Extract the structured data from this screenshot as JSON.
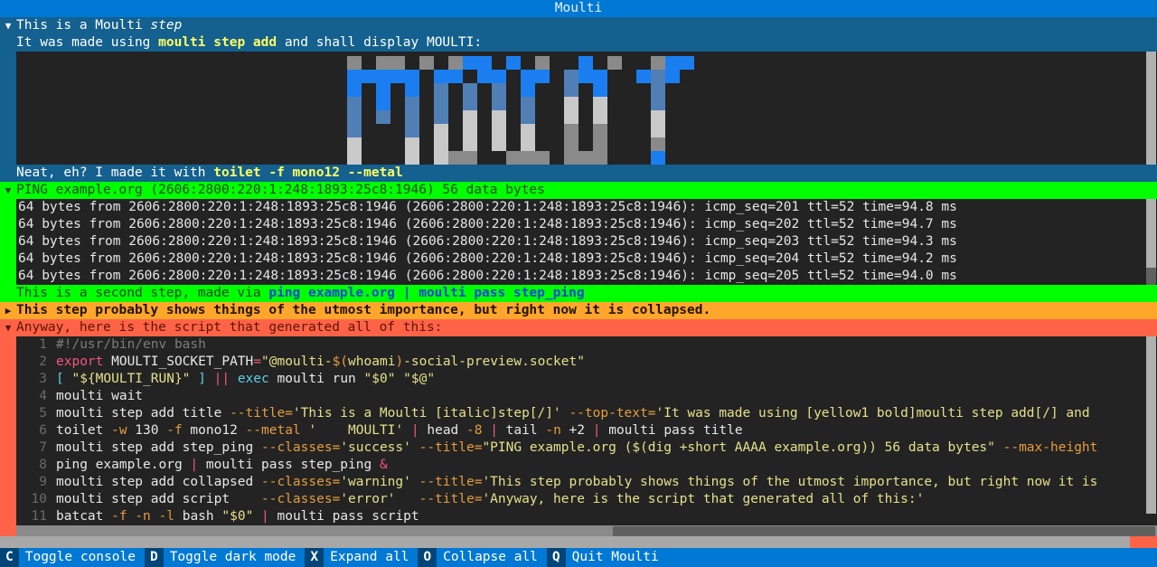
{
  "window": {
    "title": "Moulti"
  },
  "steps": [
    {
      "id": "title",
      "collapse_icon": "▼",
      "title": "This is a Moulti step",
      "title_italic_word": "step",
      "top_text_prefix": "It was made using ",
      "top_text_cmd": "moulti step add",
      "top_text_suffix": " and shall display MOULTI:",
      "bottom_text_prefix": "Neat, eh? I made it with ",
      "bottom_text_cmd": "toilet -f mono12 --metal",
      "art_alt": "MOULTI rendered as metal-style block letters"
    },
    {
      "id": "step_ping",
      "collapse_icon": "▼",
      "title": "PING example.org (2606:2800:220:1:248:1893:25c8:1946) 56 data bytes",
      "log_lines": [
        "64 bytes from 2606:2800:220:1:248:1893:25c8:1946 (2606:2800:220:1:248:1893:25c8:1946): icmp_seq=201 ttl=52 time=94.8 ms",
        "64 bytes from 2606:2800:220:1:248:1893:25c8:1946 (2606:2800:220:1:248:1893:25c8:1946): icmp_seq=202 ttl=52 time=94.7 ms",
        "64 bytes from 2606:2800:220:1:248:1893:25c8:1946 (2606:2800:220:1:248:1893:25c8:1946): icmp_seq=203 ttl=52 time=94.3 ms",
        "64 bytes from 2606:2800:220:1:248:1893:25c8:1946 (2606:2800:220:1:248:1893:25c8:1946): icmp_seq=204 ttl=52 time=94.2 ms",
        "64 bytes from 2606:2800:220:1:248:1893:25c8:1946 (2606:2800:220:1:248:1893:25c8:1946): icmp_seq=205 ttl=52 time=94.0 ms"
      ],
      "bottom_text_prefix": "This is a second step, made via ",
      "bottom_text_cmd": "ping example.org | moulti pass step_ping"
    },
    {
      "id": "collapsed",
      "collapse_icon": "▶",
      "title": "This step probably shows things of the utmost importance, but right now it is collapsed."
    },
    {
      "id": "script",
      "collapse_icon": "▼",
      "title": "Anyway, here is the script that generated all of this:"
    }
  ],
  "code": {
    "lines": [
      {
        "n": "1",
        "tokens": [
          {
            "t": "#!/usr/bin/env bash",
            "c": "c-com"
          }
        ]
      },
      {
        "n": "2",
        "tokens": [
          {
            "t": "export",
            "c": "c-kw"
          },
          {
            "t": " MOULTI_SOCKET_PATH",
            "c": "c-var"
          },
          {
            "t": "=",
            "c": "c-op"
          },
          {
            "t": "\"",
            "c": "c-str"
          },
          {
            "t": "@moulti-",
            "c": "c-str"
          },
          {
            "t": "$(",
            "c": "c-flag"
          },
          {
            "t": "whoami",
            "c": "c-str"
          },
          {
            "t": ")",
            "c": "c-flag"
          },
          {
            "t": "-social-preview.socket\"",
            "c": "c-str"
          }
        ]
      },
      {
        "n": "3",
        "tokens": [
          {
            "t": "[ ",
            "c": "c-cyan"
          },
          {
            "t": "\"${MOULTI_RUN}\"",
            "c": "c-str"
          },
          {
            "t": " ]",
            "c": "c-cyan"
          },
          {
            "t": " ||",
            "c": "c-op"
          },
          {
            "t": " exec",
            "c": "c-cyan"
          },
          {
            "t": " moulti run ",
            "c": "c-plain"
          },
          {
            "t": "\"$0\" \"$@\"",
            "c": "c-str"
          }
        ]
      },
      {
        "n": "4",
        "tokens": [
          {
            "t": "moulti wait",
            "c": "c-plain"
          }
        ]
      },
      {
        "n": "5",
        "tokens": [
          {
            "t": "moulti step add title ",
            "c": "c-plain"
          },
          {
            "t": "--title=",
            "c": "c-flag"
          },
          {
            "t": "'This is a Moulti [italic]step[/]'",
            "c": "c-str"
          },
          {
            "t": " --top-text=",
            "c": "c-flag"
          },
          {
            "t": "'It was made using [yellow1 bold]moulti step add[/] and",
            "c": "c-str"
          }
        ]
      },
      {
        "n": "6",
        "tokens": [
          {
            "t": "toilet ",
            "c": "c-plain"
          },
          {
            "t": "-w",
            "c": "c-flag"
          },
          {
            "t": " 130 ",
            "c": "c-plain"
          },
          {
            "t": "-f",
            "c": "c-flag"
          },
          {
            "t": " mono12 ",
            "c": "c-plain"
          },
          {
            "t": "--metal",
            "c": "c-flag"
          },
          {
            "t": " '    MOULTI'",
            "c": "c-str"
          },
          {
            "t": " |",
            "c": "c-op"
          },
          {
            "t": " head ",
            "c": "c-plain"
          },
          {
            "t": "-8",
            "c": "c-flag"
          },
          {
            "t": " |",
            "c": "c-op"
          },
          {
            "t": " tail ",
            "c": "c-plain"
          },
          {
            "t": "-n",
            "c": "c-flag"
          },
          {
            "t": " +2",
            "c": "c-plain"
          },
          {
            "t": " |",
            "c": "c-op"
          },
          {
            "t": " moulti pass title",
            "c": "c-plain"
          }
        ]
      },
      {
        "n": "7",
        "tokens": [
          {
            "t": "moulti step add step_ping ",
            "c": "c-plain"
          },
          {
            "t": "--classes=",
            "c": "c-flag"
          },
          {
            "t": "'success'",
            "c": "c-str"
          },
          {
            "t": " --title=",
            "c": "c-flag"
          },
          {
            "t": "\"PING example.org ($(dig +short AAAA example.org)) 56 data bytes\"",
            "c": "c-str"
          },
          {
            "t": " --max-height",
            "c": "c-flag"
          }
        ]
      },
      {
        "n": "8",
        "tokens": [
          {
            "t": "ping example.org ",
            "c": "c-plain"
          },
          {
            "t": "|",
            "c": "c-op"
          },
          {
            "t": " moulti pass step_ping ",
            "c": "c-plain"
          },
          {
            "t": "&",
            "c": "c-amp"
          }
        ]
      },
      {
        "n": "9",
        "tokens": [
          {
            "t": "moulti step add collapsed ",
            "c": "c-plain"
          },
          {
            "t": "--classes=",
            "c": "c-flag"
          },
          {
            "t": "'warning'",
            "c": "c-str"
          },
          {
            "t": " --title=",
            "c": "c-flag"
          },
          {
            "t": "'This step probably shows things of the utmost importance, but right now it is",
            "c": "c-str"
          }
        ]
      },
      {
        "n": "10",
        "tokens": [
          {
            "t": "moulti step add script    ",
            "c": "c-plain"
          },
          {
            "t": "--classes=",
            "c": "c-flag"
          },
          {
            "t": "'error'",
            "c": "c-str"
          },
          {
            "t": "   --title=",
            "c": "c-flag"
          },
          {
            "t": "'Anyway, here is the script that generated all of this:'",
            "c": "c-str"
          }
        ]
      },
      {
        "n": "11",
        "tokens": [
          {
            "t": "batcat ",
            "c": "c-plain"
          },
          {
            "t": "-f",
            "c": "c-flag"
          },
          {
            "t": " ",
            "c": "c-plain"
          },
          {
            "t": "-n",
            "c": "c-flag"
          },
          {
            "t": " ",
            "c": "c-plain"
          },
          {
            "t": "-l",
            "c": "c-flag"
          },
          {
            "t": " bash ",
            "c": "c-plain"
          },
          {
            "t": "\"$0\"",
            "c": "c-str"
          },
          {
            "t": " |",
            "c": "c-op"
          },
          {
            "t": " moulti pass script",
            "c": "c-plain"
          }
        ]
      }
    ]
  },
  "art": {
    "palette": {
      "bg": "#232323",
      "blue": "#1a7ef0",
      "steel": "#4f7fb5",
      "gray": "#8a8a8a",
      "light": "#c9c9c9"
    },
    "rows": [
      "g.gg.g.ggg.g.g..g.g..ggg",
      "bbbbb.bb.bb.bb.bbb..bbb.",
      "b.b.b.b.b.b.b..b.b...b..",
      "b.b.b.b.b.b.b..b.b...b..",
      "s.s.s.s.s.s.s..s.s...s..",
      "s...s.s.s.s.s..s.s...s..",
      "l...l.l.l.l.l..l.l...l..",
      "l...l.lll..lll.lll...l.."
    ]
  },
  "footer": {
    "bindings": [
      {
        "key": "C",
        "label": "Toggle console"
      },
      {
        "key": "D",
        "label": "Toggle dark mode"
      },
      {
        "key": "X",
        "label": "Expand all"
      },
      {
        "key": "O",
        "label": "Collapse all"
      },
      {
        "key": "Q",
        "label": "Quit Moulti"
      }
    ]
  },
  "colors": {
    "accent_blue": "#0178d4",
    "info_step": "#14608f",
    "success_step": "#00ff00",
    "warning_step": "#ffa62b",
    "error_step": "#ff6347",
    "log_bg": "#232323"
  }
}
